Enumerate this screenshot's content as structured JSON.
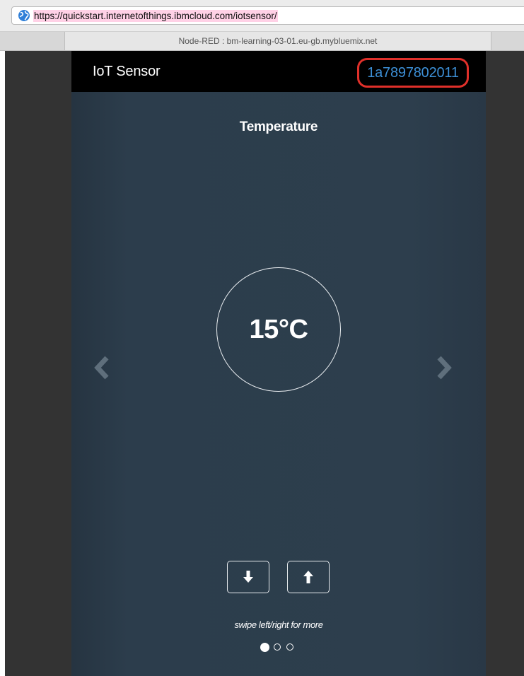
{
  "browser": {
    "url": "https://quickstart.internetofthings.ibmcloud.com/iotsensor/",
    "tab_title": "Node-RED : bm-learning-03-01.eu-gb.mybluemix.net",
    "icon": "globe-icon"
  },
  "app": {
    "title": "IoT Sensor",
    "device_id": "1a7897802011",
    "colors": {
      "header_bg": "#000000",
      "device_id": "#3d8fd6",
      "highlight": "#e0302a",
      "panel_bg": "#2d3e4d"
    }
  },
  "sensor": {
    "title": "Temperature",
    "value": "15°C"
  },
  "controls": {
    "prev_icon": "chevron-left-icon",
    "next_icon": "chevron-right-icon",
    "decrease_icon": "arrow-down-icon",
    "increase_icon": "arrow-up-icon"
  },
  "footer": {
    "hint": "swipe left/right for more",
    "page_count": 3,
    "active_page": 1
  }
}
